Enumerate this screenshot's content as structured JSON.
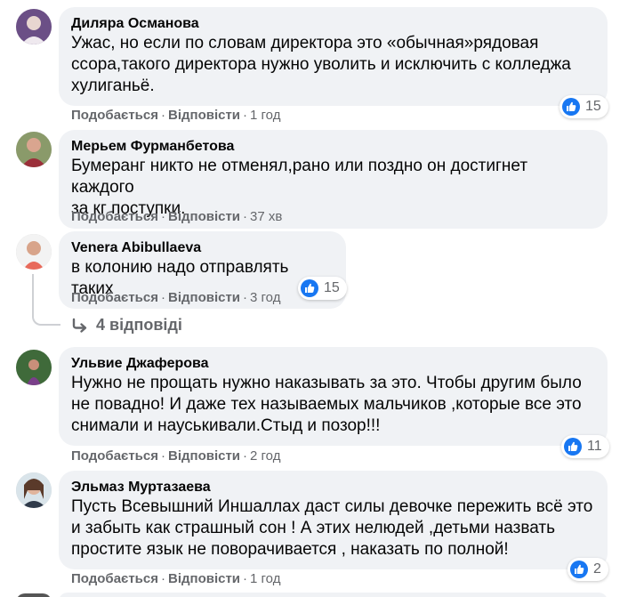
{
  "comments": [
    {
      "author": "Диляра Османова",
      "text": "Ужас, но если по словам директора это «обычная»рядовая\nссора,такого директора нужно уволить и исключить с колледжа\nхулиганьё.",
      "like_label": "Подобається",
      "reply_label": "Відповісти",
      "time": "1 год",
      "reactions": "15"
    },
    {
      "author": "Мерьем Фурманбетова",
      "text": "Бумеранг никто не отменял,рано или поздно он достигнет каждого\nза кг поступки.",
      "like_label": "Подобається",
      "reply_label": "Відповісти",
      "time": "37 хв"
    },
    {
      "author": "Venera Abibullaeva",
      "text": "в колонию надо отправлять таких",
      "like_label": "Подобається",
      "reply_label": "Відповісти",
      "time": "3 год",
      "reactions": "15",
      "replies_label": "4 відповіді"
    },
    {
      "author": "Ульвие Джаферова",
      "text": "Нужно не прощать нужно наказывать за это. Чтобы другим было\nне повадно! И даже тех называемых мальчиков ,которые все это\nснимали и науськивали.Стыд и позор!!!",
      "like_label": "Подобається",
      "reply_label": "Відповісти",
      "time": "2 год",
      "reactions": "11"
    },
    {
      "author": "Эльмаз Муртазаева",
      "text": "Пусть Всевышний Иншаллах даст силы девочке пережить всё это\nи забыть как страшный сон ! А этих нелюдей ,детьми назвать\nпростите язык не поворачивается , наказать по полной!",
      "like_label": "Подобається",
      "reply_label": "Відповісти",
      "time": "1 год",
      "reactions": "2"
    }
  ],
  "icons": {
    "reaction": "like-thumb-icon",
    "replies": "reply-arrow-icon",
    "avatar": "user-avatar"
  },
  "colors": {
    "bubble": "#f0f2f5",
    "meta_text": "#65676b",
    "like_blue": "#1877f2"
  }
}
